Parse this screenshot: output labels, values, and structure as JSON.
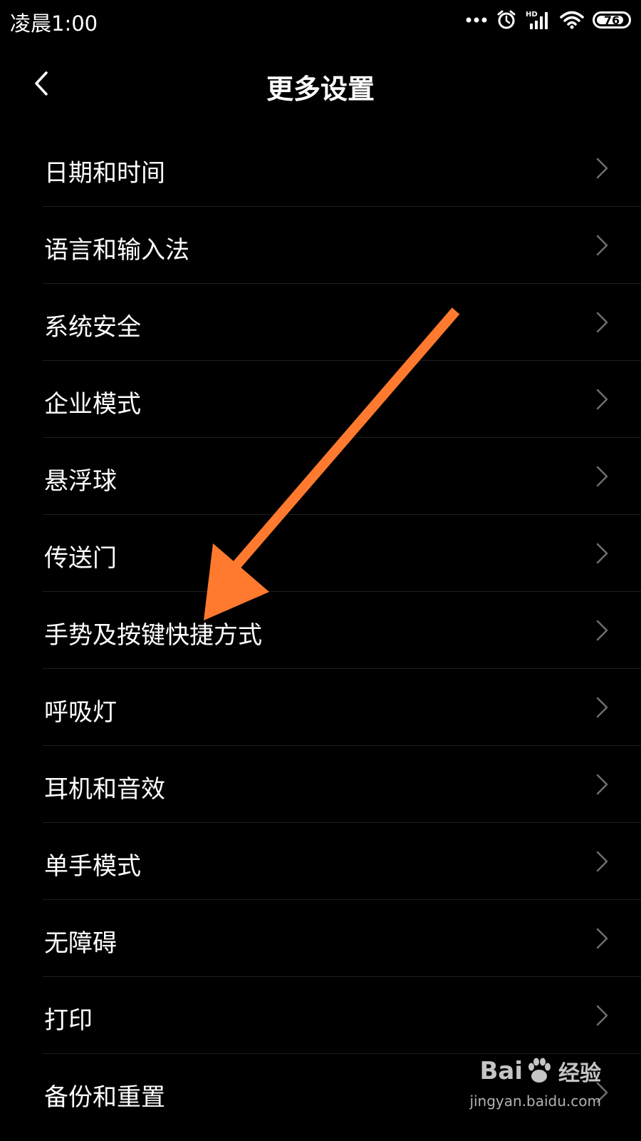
{
  "status_bar": {
    "time": "凌晨1:00",
    "battery": "76",
    "network_label": "HD"
  },
  "header": {
    "title": "更多设置"
  },
  "items": [
    {
      "label": "日期和时间"
    },
    {
      "label": "语言和输入法"
    },
    {
      "label": "系统安全"
    },
    {
      "label": "企业模式"
    },
    {
      "label": "悬浮球"
    },
    {
      "label": "传送门"
    },
    {
      "label": "手势及按键快捷方式"
    },
    {
      "label": "呼吸灯"
    },
    {
      "label": "耳机和音效"
    },
    {
      "label": "单手模式"
    },
    {
      "label": "无障碍"
    },
    {
      "label": "打印"
    },
    {
      "label": "备份和重置"
    }
  ],
  "annotation": {
    "color": "#ff7a2e",
    "target_item": "手势及按键快捷方式"
  },
  "watermark": {
    "brand_left": "Bai",
    "brand_right": "经验",
    "url": "jingyan.baidu.com"
  },
  "icons": [
    "dots-icon",
    "alarm-icon",
    "signal-icon",
    "wifi-icon",
    "battery-icon",
    "back-arrow-icon",
    "chevron-right-icon"
  ]
}
